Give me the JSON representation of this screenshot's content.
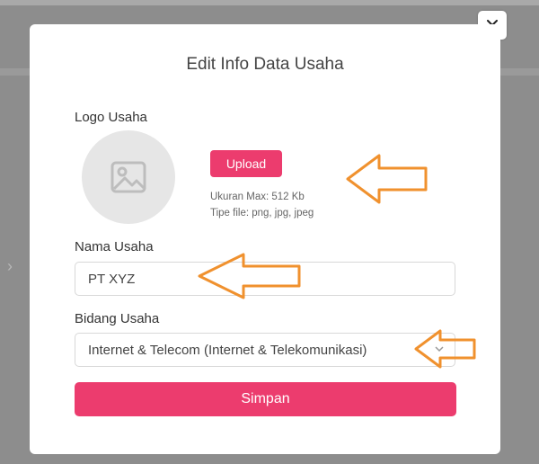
{
  "modal": {
    "title": "Edit Info Data Usaha",
    "close_label": "×"
  },
  "logo": {
    "label": "Logo Usaha",
    "upload_label": "Upload",
    "note_size": "Ukuran Max: 512 Kb",
    "note_type": "Tipe file: png, jpg, jpeg"
  },
  "nama": {
    "label": "Nama Usaha",
    "value": "PT XYZ"
  },
  "bidang": {
    "label": "Bidang Usaha",
    "value": "Internet & Telecom (Internet & Telekomunikasi)"
  },
  "actions": {
    "save_label": "Simpan"
  },
  "colors": {
    "accent": "#ec3c6e",
    "annotation_arrow": "#f0912e",
    "overlay": "#8d8d8d"
  },
  "icons": [
    "image-placeholder-icon",
    "close-icon",
    "chevron-down-icon",
    "annotation-arrow"
  ]
}
